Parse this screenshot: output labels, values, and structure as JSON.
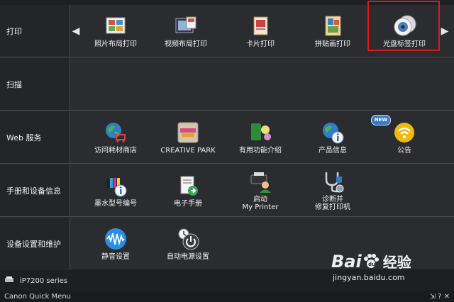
{
  "rows": [
    {
      "category": "打印",
      "items": [
        {
          "label": "照片布局打印",
          "icon": "photo-layout-icon"
        },
        {
          "label": "视频布局打印",
          "icon": "video-layout-icon"
        },
        {
          "label": "卡片打印",
          "icon": "card-print-icon"
        },
        {
          "label": "拼贴画打印",
          "icon": "collage-print-icon"
        },
        {
          "label": "光盘标签打印",
          "icon": "disc-label-icon"
        }
      ]
    },
    {
      "category": "扫描",
      "items": []
    },
    {
      "category": "Web 服务",
      "items": [
        {
          "label": "访问耗材商店",
          "icon": "globe-cart-icon"
        },
        {
          "label": "CREATIVE PARK",
          "icon": "creative-park-icon"
        },
        {
          "label": "有用功能介绍",
          "icon": "features-icon"
        },
        {
          "label": "产品信息",
          "icon": "globe-info-icon"
        },
        {
          "label": "公告",
          "icon": "announcement-icon",
          "badge": "NEW"
        }
      ]
    },
    {
      "category": "手册和设备信息",
      "items": [
        {
          "label": "墨水型号编号",
          "icon": "ink-model-icon"
        },
        {
          "label": "电子手册",
          "icon": "manual-icon"
        },
        {
          "label": "启动",
          "label2": "My Printer",
          "icon": "my-printer-icon"
        },
        {
          "label": "诊断并",
          "label2": "修复打印机",
          "icon": "diagnose-icon"
        }
      ]
    },
    {
      "category": "设备设置和维护",
      "items": [
        {
          "label": "静音设置",
          "icon": "quiet-mode-icon"
        },
        {
          "label": "自动电源设置",
          "icon": "auto-power-icon"
        }
      ]
    }
  ],
  "status": {
    "printer": "iP7200 series"
  },
  "app": {
    "title": "Canon Quick Menu",
    "controls": "⇲ ? ✕"
  },
  "watermark": {
    "brand": "Bai",
    "brand2": "du",
    "suffix": "经验",
    "url": "jingyan.baidu.com"
  },
  "colors": {
    "highlight": "#e0181b",
    "bg": "#2b2c30",
    "panel": "#242529"
  }
}
